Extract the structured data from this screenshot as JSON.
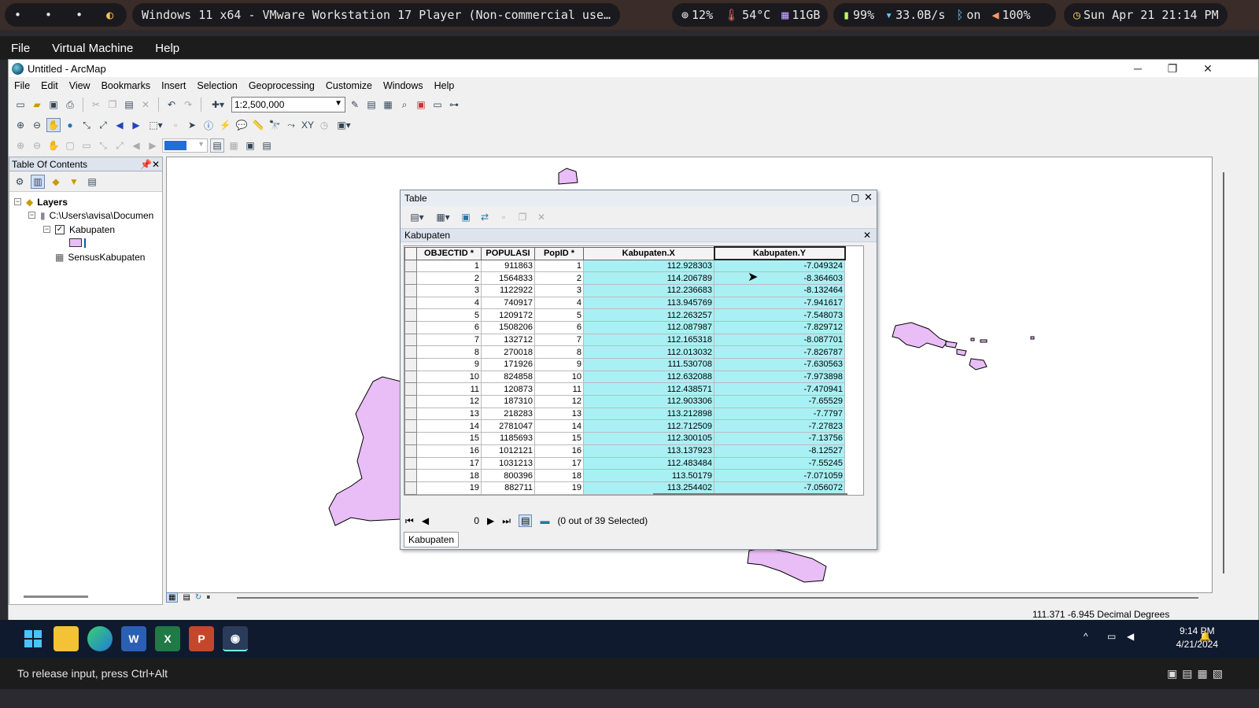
{
  "host": {
    "workspace_dots": [
      "•",
      "•",
      "•"
    ],
    "vm_title": "Windows 11 x64 - VMware Workstation 17 Player (Non-commercial use…",
    "cpu": "12%",
    "temp": "54°C",
    "ram": "11GB",
    "battery": "99%",
    "net": "33.0B/s",
    "bt": "on",
    "vol": "100%",
    "datetime": "Sun Apr 21 21:14 PM"
  },
  "vm_menu": [
    "File",
    "Virtual Machine",
    "Help"
  ],
  "app": {
    "title": "Untitled - ArcMap",
    "menu": [
      "File",
      "Edit",
      "View",
      "Bookmarks",
      "Insert",
      "Selection",
      "Geoprocessing",
      "Customize",
      "Windows",
      "Help"
    ],
    "scale": "1:2,500,000",
    "toc": {
      "title": "Table Of Contents",
      "root": "Layers",
      "path": "C:\\Users\\avisa\\Documen",
      "layer": "Kabupaten",
      "table": "SensusKabupaten"
    },
    "status_coords": "111.371  -6.945 Decimal Degrees"
  },
  "table_window": {
    "title": "Table",
    "layer": "Kabupaten",
    "columns": [
      "OBJECTID *",
      "POPULASI",
      "PopID *",
      "Kabupaten.X",
      "Kabupaten.Y"
    ],
    "rows": [
      [
        "1",
        "911863",
        "1",
        "112.928303",
        "-7.049324"
      ],
      [
        "2",
        "1564833",
        "2",
        "114.206789",
        "-8.364603"
      ],
      [
        "3",
        "1122922",
        "3",
        "112.236683",
        "-8.132464"
      ],
      [
        "4",
        "740917",
        "4",
        "113.945769",
        "-7.941617"
      ],
      [
        "5",
        "1209172",
        "5",
        "112.263257",
        "-7.548073"
      ],
      [
        "6",
        "1508206",
        "6",
        "112.087987",
        "-7.829712"
      ],
      [
        "7",
        "132712",
        "7",
        "112.165318",
        "-8.087701"
      ],
      [
        "8",
        "270018",
        "8",
        "112.013032",
        "-7.826787"
      ],
      [
        "9",
        "171926",
        "9",
        "111.530708",
        "-7.630563"
      ],
      [
        "10",
        "824858",
        "10",
        "112.632088",
        "-7.973898"
      ],
      [
        "11",
        "120873",
        "11",
        "112.438571",
        "-7.470941"
      ],
      [
        "12",
        "187310",
        "12",
        "112.903306",
        "-7.65529"
      ],
      [
        "13",
        "218283",
        "13",
        "113.212898",
        "-7.7797"
      ],
      [
        "14",
        "2781047",
        "14",
        "112.712509",
        "-7.27823"
      ],
      [
        "15",
        "1185693",
        "15",
        "112.300105",
        "-7.13756"
      ],
      [
        "16",
        "1012121",
        "16",
        "113.137923",
        "-8.12527"
      ],
      [
        "17",
        "1031213",
        "17",
        "112.483484",
        "-7.55245"
      ],
      [
        "18",
        "800396",
        "18",
        "113.50179",
        "-7.071059"
      ],
      [
        "19",
        "882711",
        "19",
        "113.254402",
        "-7.056072"
      ]
    ],
    "record": "0",
    "selection_status": "(0 out of 39 Selected)",
    "tab": "Kabupaten"
  },
  "taskbar": {
    "time": "9:14 PM",
    "date": "4/21/2024"
  },
  "vm_hint": "To release input, press Ctrl+Alt",
  "colors": {
    "polygon_fill": "#e9bdf5",
    "selected_col": "#a9f0f4",
    "taskbar": "#0f1a2e"
  }
}
